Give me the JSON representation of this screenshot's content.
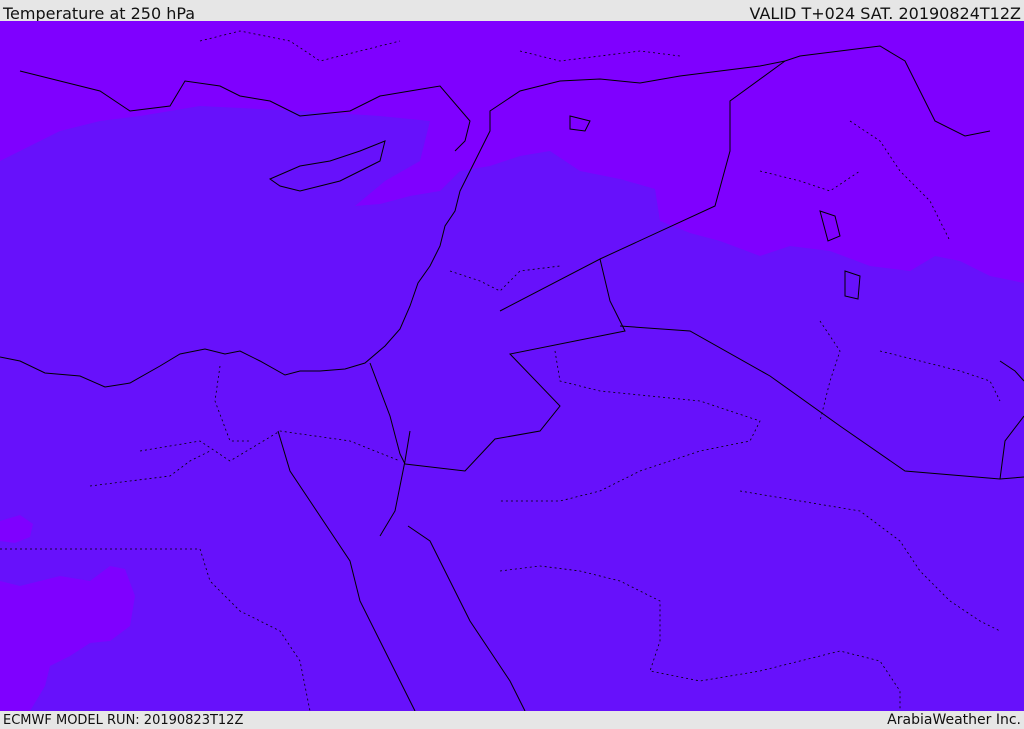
{
  "header": {
    "title": "Temperature at 250 hPa",
    "valid": "VALID T+024 SAT. 20190824T12Z"
  },
  "footer": {
    "model_run": "ECMWF MODEL RUN: 20190823T12Z",
    "credit": "ArabiaWeather Inc."
  },
  "map": {
    "colors": {
      "warmer_band": "#6711fb",
      "cooler_band": "#7f00ff",
      "coastline": "#000000",
      "border": "#000000"
    }
  }
}
